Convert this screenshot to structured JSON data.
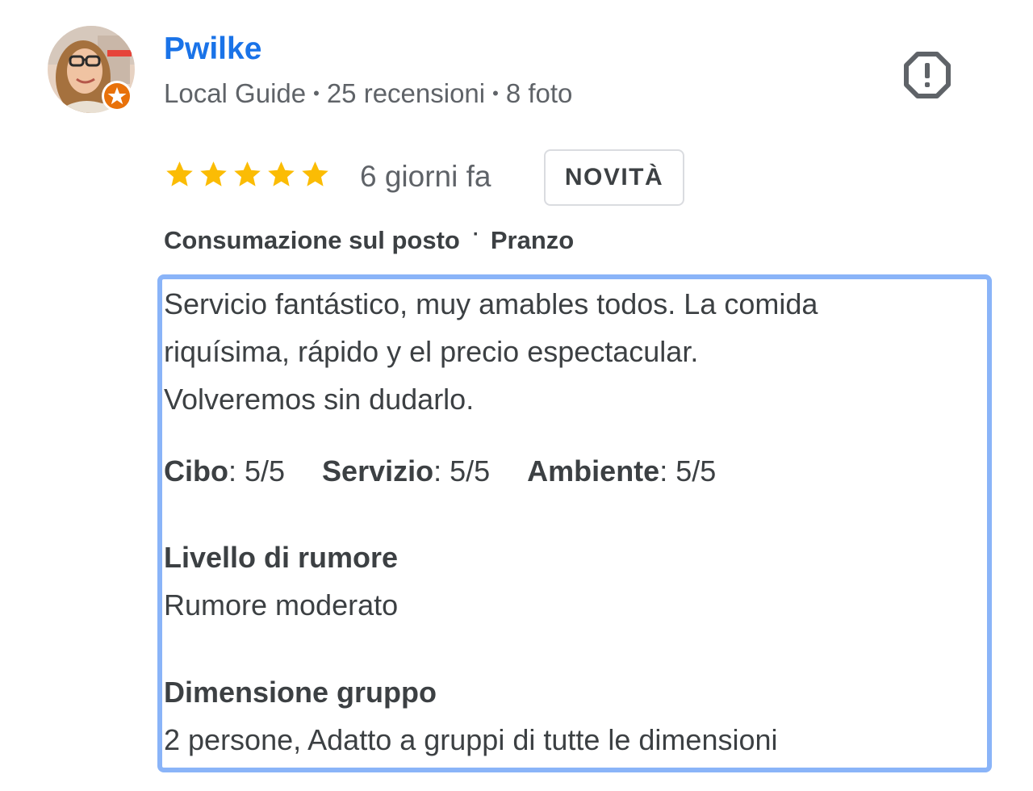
{
  "reviewer": {
    "name": "Pwilke",
    "level": "Local Guide",
    "reviews_count": "25 recensioni",
    "photos_count": "8 foto",
    "avatar_icon": "person-photo-icon",
    "badge_icon": "local-guide-star-badge-icon",
    "badge_color": "#e8710a"
  },
  "actions": {
    "report_icon": "report-exclamation-icon"
  },
  "review": {
    "rating": 5,
    "rating_max": 5,
    "star_color": "#fbbc04",
    "time": "6 giorni fa",
    "badge": "NOVITÀ",
    "tags": [
      "Consumazione sul posto",
      "Pranzo"
    ],
    "tag_separator": "·",
    "text_lines": [
      "Servicio fantástico, muy amables todos. La comida",
      "riquísima, rápido y el precio espectacular.",
      "Volveremos sin dudarlo."
    ],
    "sub_ratings": [
      {
        "label": "Cibo",
        "value": "5/5"
      },
      {
        "label": "Servizio",
        "value": "5/5"
      },
      {
        "label": "Ambiente",
        "value": "5/5"
      }
    ],
    "attributes": [
      {
        "title": "Livello di rumore",
        "value": "Rumore moderato"
      },
      {
        "title": "Dimensione gruppo",
        "value": "2 persone, Adatto a gruppi di tutte le dimensioni"
      }
    ],
    "highlight_color": "#8ab4f8"
  },
  "colors": {
    "link": "#1a73e8",
    "secondary_text": "#5f6368",
    "primary_text": "#3c4043"
  }
}
